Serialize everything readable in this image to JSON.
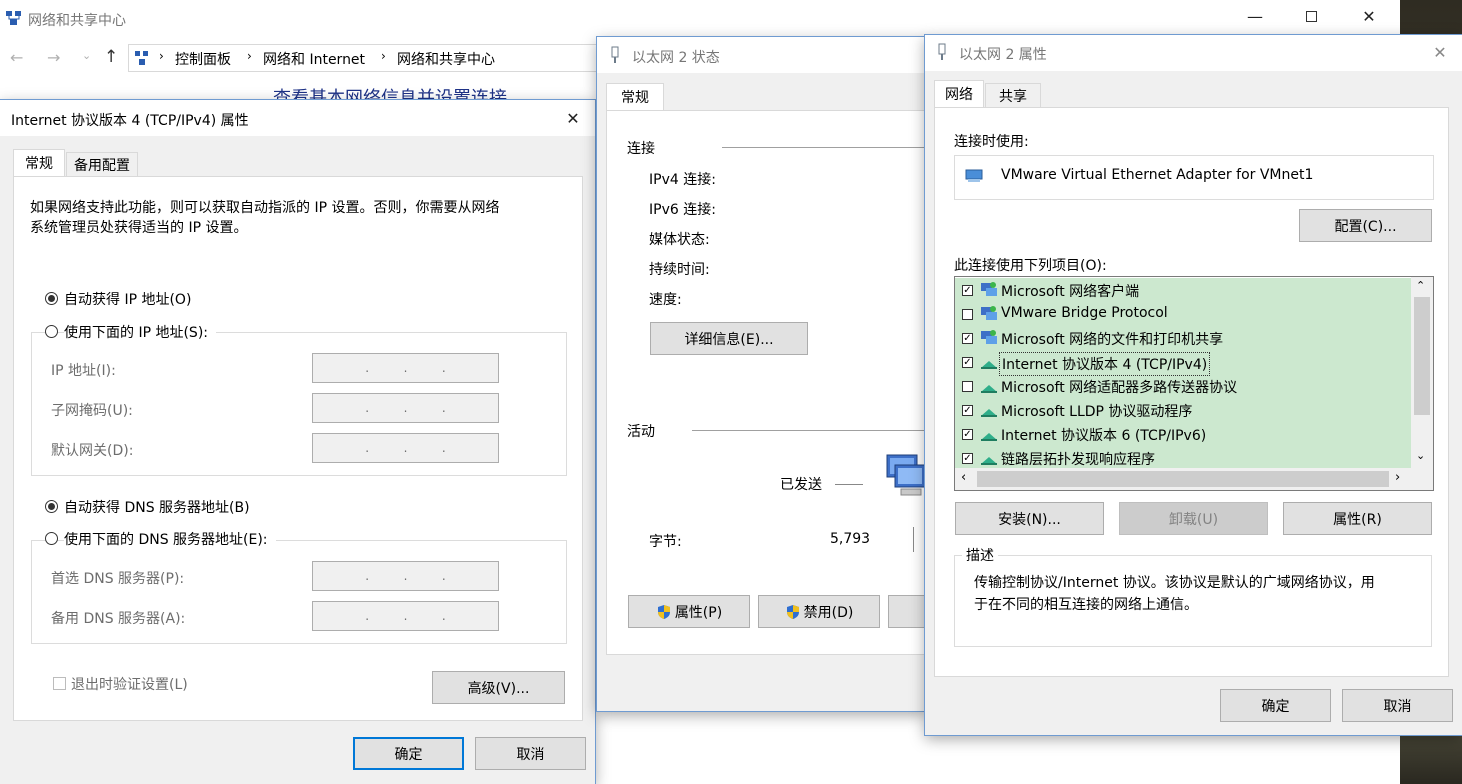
{
  "bg_window": {
    "title": "网络和共享中心",
    "breadcrumb": [
      "控制面板",
      "网络和 Internet",
      "网络和共享中心"
    ],
    "heading": "查看基本网络信息并设置连接"
  },
  "ipv4_dialog": {
    "title": "Internet 协议版本 4 (TCP/IPv4) 属性",
    "tabs": [
      "常规",
      "备用配置"
    ],
    "description": [
      "如果网络支持此功能，则可以获取自动指派的 IP 设置。否则，你需要从网络",
      "系统管理员处获得适当的 IP 设置。"
    ],
    "radio_auto_ip": "自动获得 IP 地址(O)",
    "radio_manual_ip": "使用下面的 IP 地址(S):",
    "ip_address_label": "IP 地址(I):",
    "subnet_label": "子网掩码(U):",
    "gateway_label": "默认网关(D):",
    "radio_auto_dns": "自动获得 DNS 服务器地址(B)",
    "radio_manual_dns": "使用下面的 DNS 服务器地址(E):",
    "preferred_dns_label": "首选 DNS 服务器(P):",
    "alternate_dns_label": "备用 DNS 服务器(A):",
    "validate_label": "退出时验证设置(L)",
    "advanced_button": "高级(V)...",
    "ok_button": "确定",
    "cancel_button": "取消"
  },
  "status_dialog": {
    "title": "以太网 2 状态",
    "tab": "常规",
    "connection_group": "连接",
    "ipv4_label": "IPv4 连接:",
    "ipv6_label": "IPv6 连接:",
    "media_label": "媒体状态:",
    "duration_label": "持续时间:",
    "speed_label": "速度:",
    "details_button": "详细信息(E)...",
    "activity_group": "活动",
    "sent_label": "已发送",
    "bytes_label": "字节:",
    "bytes_sent": "5,793",
    "properties_button": "属性(P)",
    "disable_button": "禁用(D)"
  },
  "props_dialog": {
    "title": "以太网 2 属性",
    "tabs": [
      "网络",
      "共享"
    ],
    "connect_using_label": "连接时使用:",
    "adapter_name": "VMware Virtual Ethernet Adapter for VMnet1",
    "configure_button": "配置(C)...",
    "items_label": "此连接使用下列项目(O):",
    "items": [
      {
        "label": "Microsoft 网络客户端",
        "checked": true,
        "icon": "network-client-icon"
      },
      {
        "label": "VMware Bridge Protocol",
        "checked": false,
        "icon": "network-client-icon"
      },
      {
        "label": "Microsoft 网络的文件和打印机共享",
        "checked": true,
        "icon": "network-client-icon"
      },
      {
        "label": "Internet 协议版本 4 (TCP/IPv4)",
        "checked": true,
        "icon": "protocol-icon"
      },
      {
        "label": "Microsoft 网络适配器多路传送器协议",
        "checked": false,
        "icon": "protocol-icon"
      },
      {
        "label": "Microsoft LLDP 协议驱动程序",
        "checked": true,
        "icon": "protocol-icon"
      },
      {
        "label": "Internet 协议版本 6 (TCP/IPv6)",
        "checked": true,
        "icon": "protocol-icon"
      },
      {
        "label": "链路层拓扑发现响应程序",
        "checked": true,
        "icon": "protocol-icon"
      }
    ],
    "install_button": "安装(N)...",
    "uninstall_button": "卸载(U)",
    "properties_button": "属性(R)",
    "description_group": "描述",
    "description_text": [
      "传输控制协议/Internet 协议。该协议是默认的广域网络协议，用",
      "于在不同的相互连接的网络上通信。"
    ],
    "ok_button": "确定",
    "cancel_button": "取消"
  },
  "colors": {
    "accent": "#0078d7",
    "list_highlight": "#cce8cf",
    "link_blue": "#1e3287"
  }
}
